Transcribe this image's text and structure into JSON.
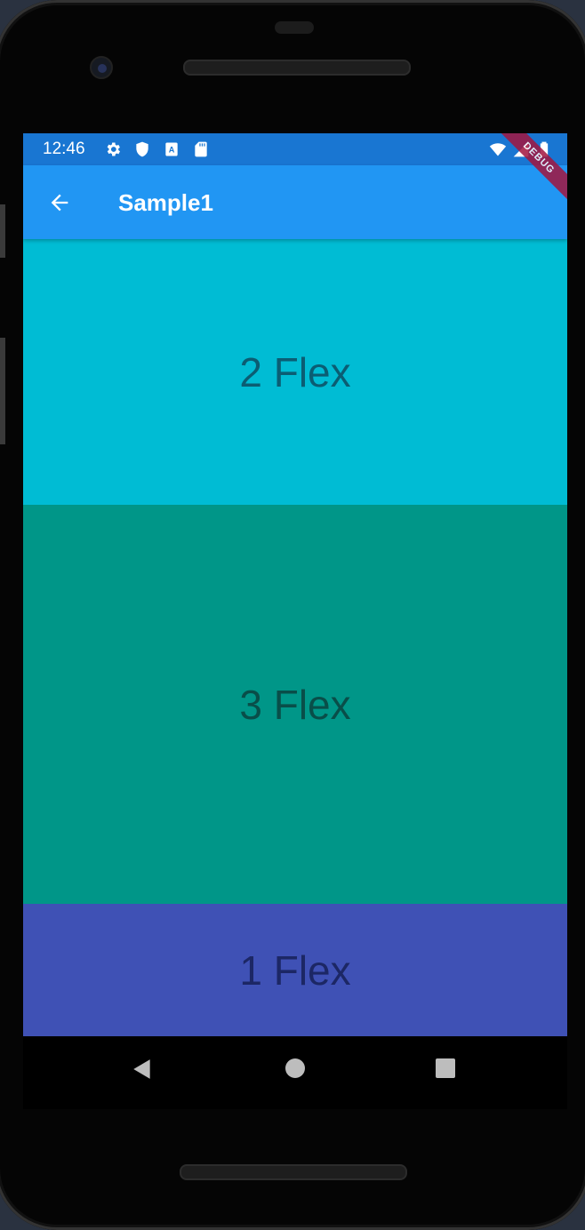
{
  "status_bar": {
    "time": "12:46",
    "left_icons": [
      "gear-icon",
      "shield-icon",
      "a-badge-icon",
      "sd-card-icon"
    ],
    "right_icons": [
      "wifi-icon",
      "cell-signal-icon",
      "battery-icon"
    ]
  },
  "debug_banner": "DEBUG",
  "app_bar": {
    "title": "Sample1",
    "back_icon": "arrow-back-icon",
    "color": "#2196f3"
  },
  "blocks": [
    {
      "label": "2 Flex",
      "flex": 2,
      "color": "#00bcd4"
    },
    {
      "label": "3 Flex",
      "flex": 3,
      "color": "#009688"
    },
    {
      "label": "1 Flex",
      "flex": 1,
      "color": "#3f51b5"
    }
  ],
  "nav_bar": {
    "icons": [
      "back-triangle-icon",
      "home-circle-icon",
      "recents-square-icon"
    ]
  }
}
